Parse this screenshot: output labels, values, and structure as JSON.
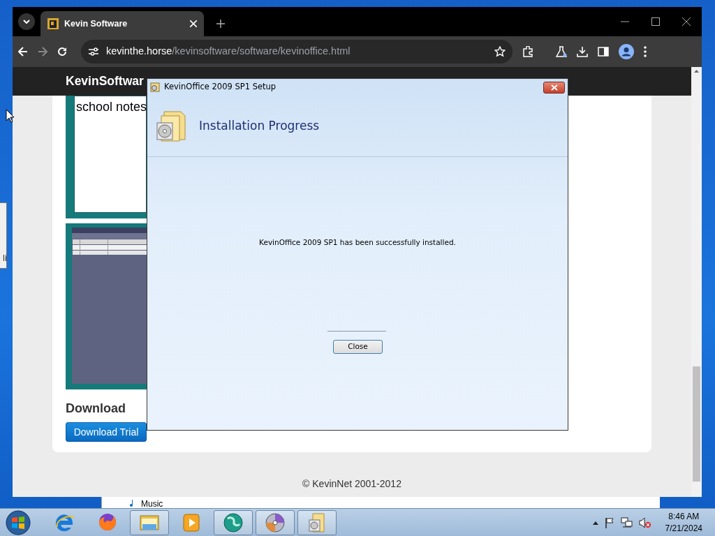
{
  "background_windows": {
    "side_text": "li",
    "folder_item": "Music"
  },
  "browser": {
    "tabs": [
      {
        "title": "Kevin Software",
        "selected": true
      }
    ],
    "address": {
      "host": "kevinthe.horse",
      "path": "/kevinsoftware/software/kevinoffice.html"
    }
  },
  "page": {
    "brand": "KevinSoftwar",
    "screenshot_caption": "school notes",
    "download_heading": "Download",
    "download_button": "Download Trial",
    "footer": "© KevinNet 2001-2012"
  },
  "dialog": {
    "title": "KevinOffice 2009 SP1 Setup",
    "heading": "Installation Progress",
    "message": "KevinOffice 2009 SP1 has been successfully installed.",
    "button": "Close"
  },
  "taskbar": {
    "items": [
      {
        "kind": "browser-e",
        "running": false
      },
      {
        "kind": "fox",
        "running": false
      },
      {
        "kind": "folder",
        "running": true
      },
      {
        "kind": "player",
        "running": false
      },
      {
        "kind": "globe",
        "running": true
      },
      {
        "kind": "disc",
        "running": true
      },
      {
        "kind": "setup",
        "running": true
      }
    ],
    "time": "8:46 AM",
    "date": "7/21/2024"
  }
}
